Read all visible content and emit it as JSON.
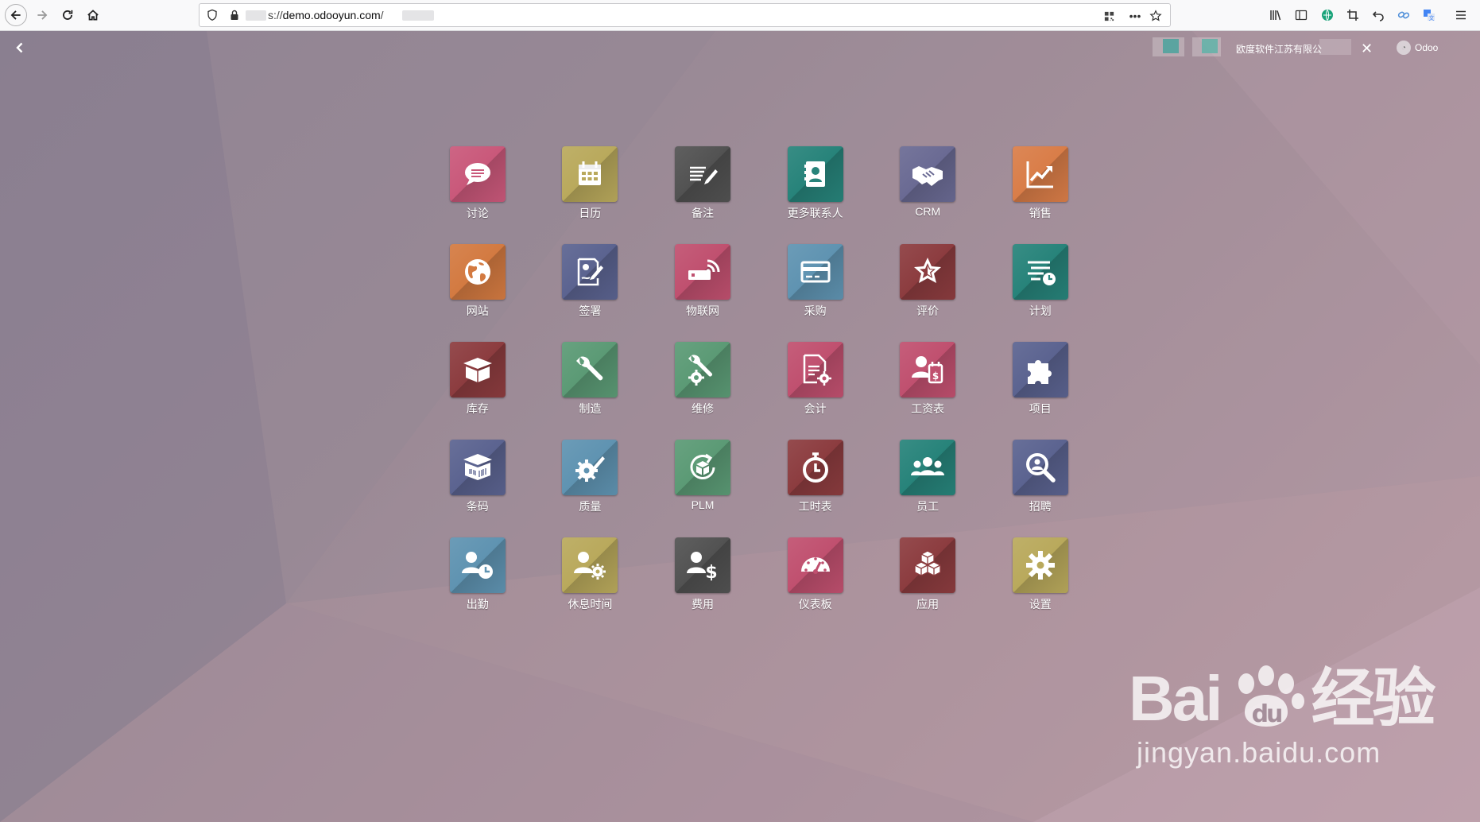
{
  "browser": {
    "url_prefix": "s://",
    "url_host": "demo.odooyun.com",
    "url_suffix": "/"
  },
  "header": {
    "company_name": "欧度软件江苏有限公",
    "user_name": "Odoo"
  },
  "apps": [
    {
      "label": "讨论",
      "icon": "chat-icon",
      "color": "#c9587a"
    },
    {
      "label": "日历",
      "icon": "calendar-icon",
      "color": "#b9a95c"
    },
    {
      "label": "备注",
      "icon": "note-pencil-icon",
      "color": "#525252"
    },
    {
      "label": "更多联系人",
      "icon": "contacts-icon",
      "color": "#27837a"
    },
    {
      "label": "CRM",
      "icon": "handshake-icon",
      "color": "#6a6a93"
    },
    {
      "label": "销售",
      "icon": "chart-trend-icon",
      "color": "#d97d48"
    },
    {
      "label": "网站",
      "icon": "globe-icon",
      "color": "#d37a41"
    },
    {
      "label": "签署",
      "icon": "sign-document-icon",
      "color": "#5b6390"
    },
    {
      "label": "物联网",
      "icon": "iot-icon",
      "color": "#c0506f"
    },
    {
      "label": "采购",
      "icon": "credit-card-icon",
      "color": "#5f93b1"
    },
    {
      "label": "评价",
      "icon": "star-icon",
      "color": "#8c3c3f"
    },
    {
      "label": "计划",
      "icon": "planning-icon",
      "color": "#27837a"
    },
    {
      "label": "库存",
      "icon": "box-icon",
      "color": "#8c3c3f"
    },
    {
      "label": "制造",
      "icon": "wrench-icon",
      "color": "#5b9a75"
    },
    {
      "label": "维修",
      "icon": "wrench-gear-icon",
      "color": "#5b9a75"
    },
    {
      "label": "会计",
      "icon": "invoice-gear-icon",
      "color": "#c0506f"
    },
    {
      "label": "工资表",
      "icon": "payroll-icon",
      "color": "#c0506f"
    },
    {
      "label": "项目",
      "icon": "puzzle-icon",
      "color": "#5b6390"
    },
    {
      "label": "条码",
      "icon": "barcode-box-icon",
      "color": "#5b6390"
    },
    {
      "label": "质量",
      "icon": "quality-gear-icon",
      "color": "#5f93b1"
    },
    {
      "label": "PLM",
      "icon": "plm-cycle-icon",
      "color": "#5b9a75"
    },
    {
      "label": "工时表",
      "icon": "stopwatch-icon",
      "color": "#8c3c3f"
    },
    {
      "label": "员工",
      "icon": "people-icon",
      "color": "#27837a"
    },
    {
      "label": "招聘",
      "icon": "magnifier-icon",
      "color": "#5b6390"
    },
    {
      "label": "出勤",
      "icon": "user-clock-icon",
      "color": "#5f93b1"
    },
    {
      "label": "休息时间",
      "icon": "user-gear-icon",
      "color": "#b9a95c"
    },
    {
      "label": "费用",
      "icon": "user-dollar-icon",
      "color": "#525252"
    },
    {
      "label": "仪表板",
      "icon": "gauge-icon",
      "color": "#c0506f"
    },
    {
      "label": "应用",
      "icon": "cubes-icon",
      "color": "#8c3c3f"
    },
    {
      "label": "设置",
      "icon": "settings-gear-icon",
      "color": "#b9a95c"
    }
  ],
  "watermark": {
    "brand_left": "Bai",
    "brand_right": "经验",
    "subdomain": "jingyan.baidu.com"
  }
}
